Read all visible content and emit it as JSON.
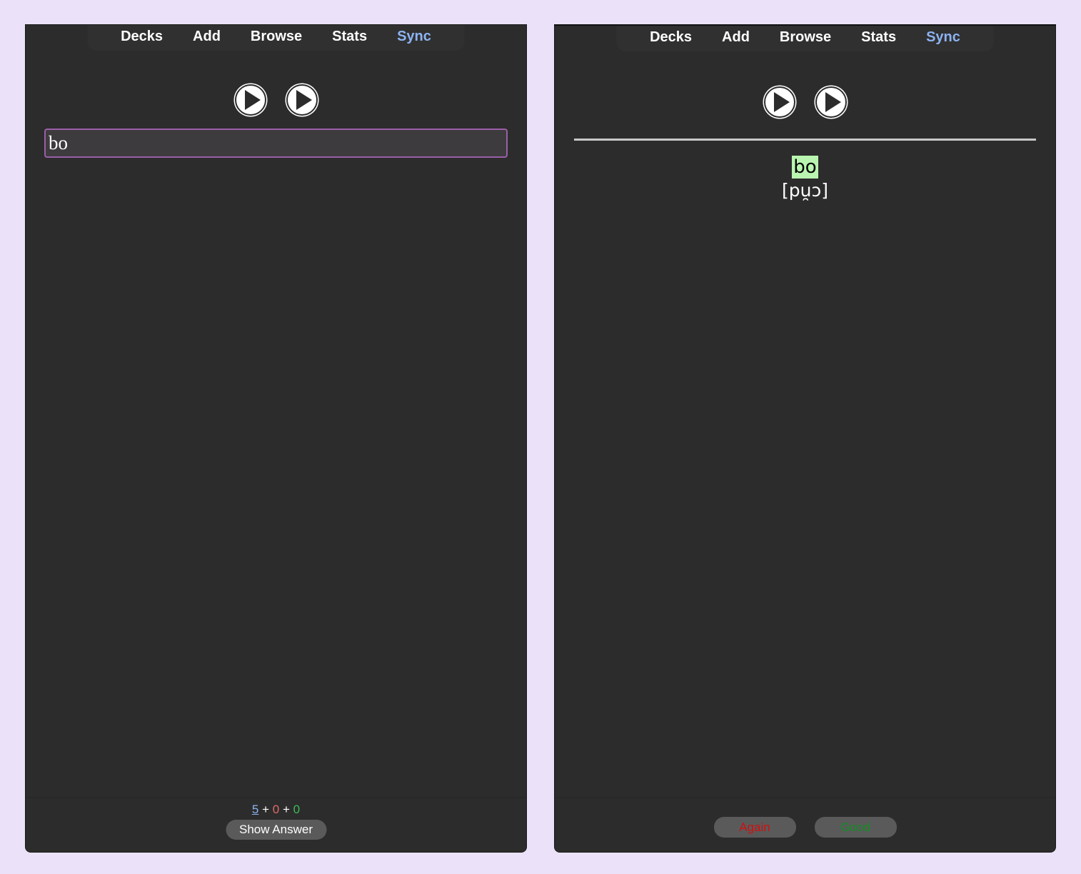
{
  "nav": {
    "items": [
      "Decks",
      "Add",
      "Browse",
      "Stats",
      "Sync"
    ]
  },
  "front": {
    "typed_value": "bo"
  },
  "back": {
    "typed_answer": "bo",
    "ipa": "[pu̯ɔ]"
  },
  "counts": {
    "new": "5",
    "learn": "0",
    "review": "0",
    "sep": "+"
  },
  "buttons": {
    "show_answer": "Show Answer",
    "again": "Again",
    "good": "Good"
  },
  "icons": {
    "play": "play-icon"
  },
  "colors": {
    "background": "#ebe2f9",
    "window": "#2c2c2c",
    "sync": "#8cb3f2",
    "typein_border": "#9a5fa8",
    "typed_good_bg": "#b9f5b0",
    "count_new": "#8cb3f2",
    "count_learn": "#e06a6a",
    "count_review": "#3cba57",
    "again": "#d10f0f",
    "good": "#118f23"
  }
}
